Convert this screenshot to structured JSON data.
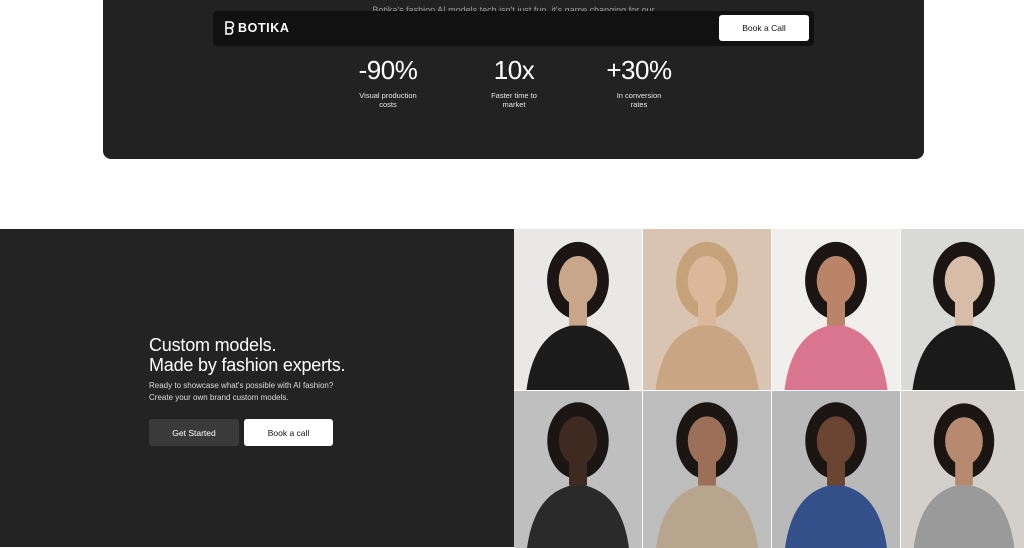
{
  "stats_section": {
    "clipped_text": "Botika's fashion AI models tech isn't just fun, it's game changing for our",
    "stats": [
      {
        "value": "-90%",
        "label_line1": "Visual production",
        "label_line2": "costs"
      },
      {
        "value": "10x",
        "label_line1": "Faster time to",
        "label_line2": "market"
      },
      {
        "value": "+30%",
        "label_line1": "In conversion",
        "label_line2": "rates"
      }
    ]
  },
  "navbar": {
    "logo_text": "BOTIKA",
    "cta_label": "Book a Call"
  },
  "models_section": {
    "headline_line1": "Custom models.",
    "headline_line2": "Made by fashion experts.",
    "subcopy_line1": "Ready to showcase what's possible with AI fashion?",
    "subcopy_line2": "Create your own brand custom models.",
    "primary_button": "Get Started",
    "secondary_button": "Book a call"
  },
  "gallery": {
    "tiles": [
      {
        "icon": "model-photo",
        "bg": "#e9e8e6",
        "fg": "#1c1c1c",
        "skin": "#c9a58a"
      },
      {
        "icon": "model-photo",
        "bg": "#d8c4b0",
        "fg": "#c9a584",
        "skin": "#dcb79a"
      },
      {
        "icon": "model-photo",
        "bg": "#f1efec",
        "fg": "#d9758f",
        "skin": "#b98468"
      },
      {
        "icon": "model-photo",
        "bg": "#d9d9d7",
        "fg": "#1a1a1a",
        "skin": "#d7bca7"
      },
      {
        "icon": "model-photo",
        "bg": "#bfbfbf",
        "fg": "#2a2a2a",
        "skin": "#3e2a21"
      },
      {
        "icon": "model-photo",
        "bg": "#bdbdbd",
        "fg": "#b8a58e",
        "skin": "#9c7058"
      },
      {
        "icon": "model-photo",
        "bg": "#b9b9b9",
        "fg": "#33508a",
        "skin": "#6b4532"
      },
      {
        "icon": "model-photo",
        "bg": "#d3cfca",
        "fg": "#9a9a9a",
        "skin": "#b78a6f"
      }
    ]
  }
}
